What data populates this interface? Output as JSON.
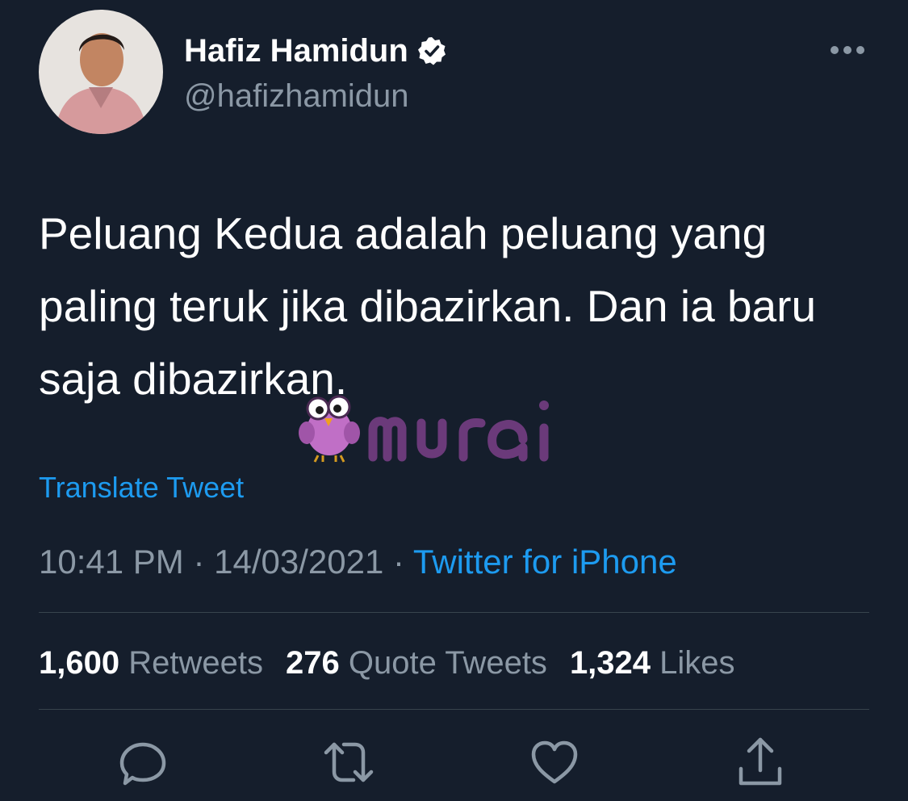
{
  "author": {
    "display_name": "Hafiz Hamidun",
    "handle": "@hafizhamidun",
    "verified": true
  },
  "tweet": {
    "text": "Peluang Kedua adalah peluang yang paling teruk jika dibazirkan. Dan ia baru saja dibazirkan.",
    "translate_label": "Translate Tweet",
    "time": "10:41 PM",
    "separator": " · ",
    "date": "14/03/2021",
    "source": "Twitter for iPhone"
  },
  "stats": {
    "retweets_count": "1,600",
    "retweets_label": "Retweets",
    "quotes_count": "276",
    "quotes_label": "Quote Tweets",
    "likes_count": "1,324",
    "likes_label": "Likes"
  },
  "watermark": {
    "brand": "murai",
    "brand_color": "#6b3a7a"
  },
  "actions": [
    "reply-icon",
    "retweet-icon",
    "like-icon",
    "share-icon"
  ],
  "colors": {
    "background": "#151e2c",
    "link": "#1d9bf0",
    "secondary_text": "#8b98a5"
  }
}
